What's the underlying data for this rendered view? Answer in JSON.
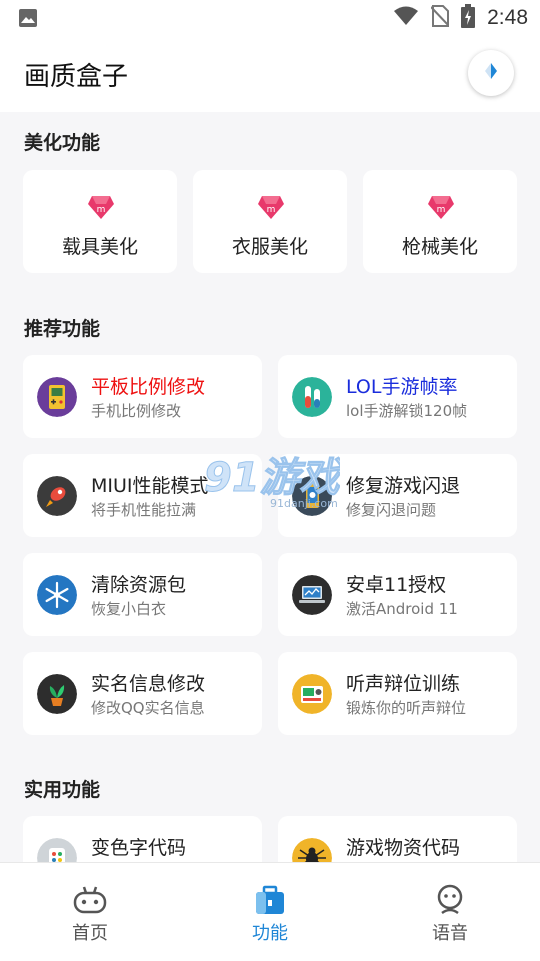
{
  "status_bar": {
    "time": "2:48",
    "icons": [
      "image-icon",
      "wifi-icon",
      "no-sim-icon",
      "battery-charging-icon"
    ]
  },
  "app_bar": {
    "title": "画质盒子",
    "action_icon": "compass-icon"
  },
  "sections": {
    "beautify": {
      "title": "美化功能",
      "items": [
        {
          "label": "载具美化",
          "icon": "pink-m-badge-icon"
        },
        {
          "label": "衣服美化",
          "icon": "pink-m-badge-icon"
        },
        {
          "label": "枪械美化",
          "icon": "pink-m-badge-icon"
        }
      ]
    },
    "recommended": {
      "title": "推荐功能",
      "items": [
        {
          "title": "平板比例修改",
          "subtitle": "手机比例修改",
          "icon": "gameboy-icon",
          "title_color": "#ee1111"
        },
        {
          "title": "LOL手游帧率",
          "subtitle": "lol手游解锁120帧",
          "icon": "test-tubes-icon",
          "title_color": "#1a2ddc"
        },
        {
          "title": "MIUI性能模式",
          "subtitle": "将手机性能拉满",
          "icon": "rocket-icon"
        },
        {
          "title": "修复游戏闪退",
          "subtitle": "修复闪退问题",
          "icon": "phone-repair-icon"
        },
        {
          "title": "清除资源包",
          "subtitle": "恢复小白衣",
          "icon": "snowflake-icon"
        },
        {
          "title": "安卓11授权",
          "subtitle": "激活Android 11",
          "icon": "laptop-icon"
        },
        {
          "title": "实名信息修改",
          "subtitle": "修改QQ实名信息",
          "icon": "plant-icon"
        },
        {
          "title": "听声辩位训练",
          "subtitle": "锻炼你的听声辩位",
          "icon": "radio-icon"
        }
      ]
    },
    "utilities": {
      "title": "实用功能",
      "items": [
        {
          "title": "变色字代码",
          "icon": "palette-icon"
        },
        {
          "title": "游戏物资代码",
          "icon": "spider-icon"
        }
      ]
    }
  },
  "watermark": {
    "brand": "91游戏",
    "domain": "91danji.com"
  },
  "bottom_nav": {
    "items": [
      {
        "label": "首页",
        "icon": "gamepad-icon",
        "active": false
      },
      {
        "label": "功能",
        "icon": "toolbox-icon",
        "active": true
      },
      {
        "label": "语音",
        "icon": "voice-bot-icon",
        "active": false
      }
    ]
  },
  "colors": {
    "accent": "#1f86d6",
    "badge_pink": "#e8396b",
    "background": "#f6f6f8"
  }
}
